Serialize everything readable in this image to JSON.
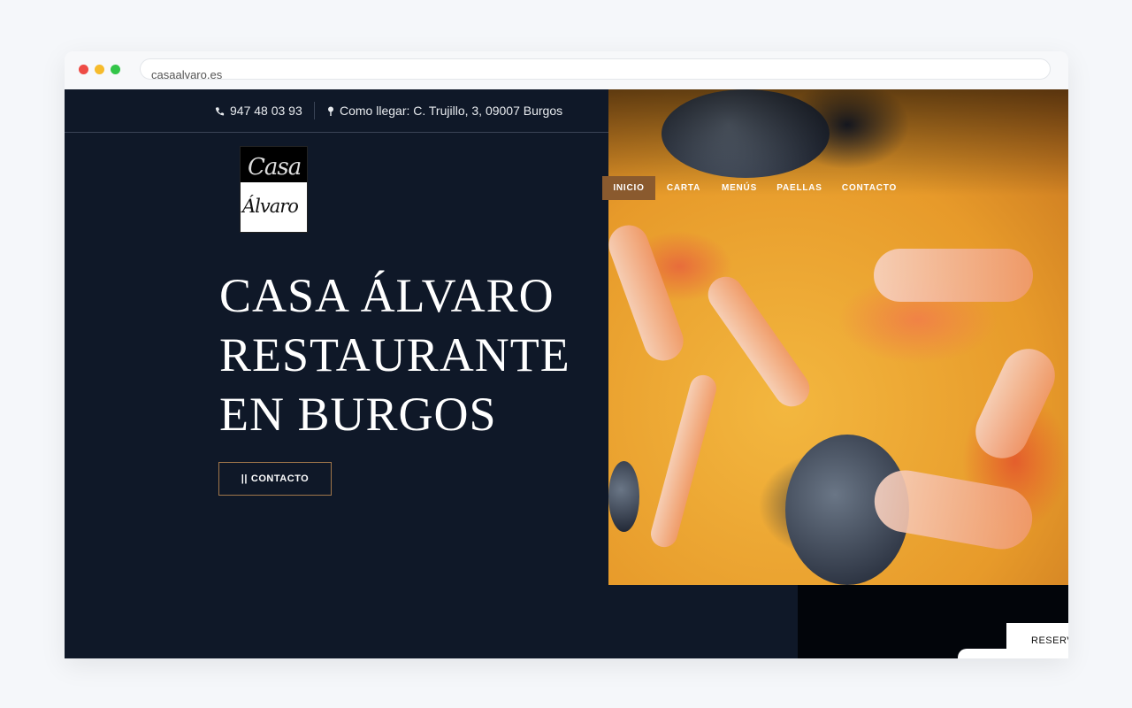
{
  "browser": {
    "url": "casaalvaro.es"
  },
  "topbar": {
    "phone": "947 48 03 93",
    "address": "Como llegar: C. Trujillo, 3, 09007 Burgos"
  },
  "logo": {
    "line1": "Casa",
    "line2": "Álvaro"
  },
  "nav": {
    "items": [
      "INICIO",
      "CARTA",
      "MENÚS",
      "PAELLAS",
      "CONTACTO"
    ],
    "active": "INICIO"
  },
  "hero": {
    "title_lines": [
      "CASA ÁLVARO",
      "RESTAURANTE",
      "EN BURGOS"
    ],
    "button_label": "CONTACTO",
    "button_prefix": "||"
  },
  "reserve": {
    "label": "RESERV"
  },
  "colors": {
    "background": "#0f1828",
    "accent": "#8a5a2e",
    "button_border": "#a0764a"
  }
}
